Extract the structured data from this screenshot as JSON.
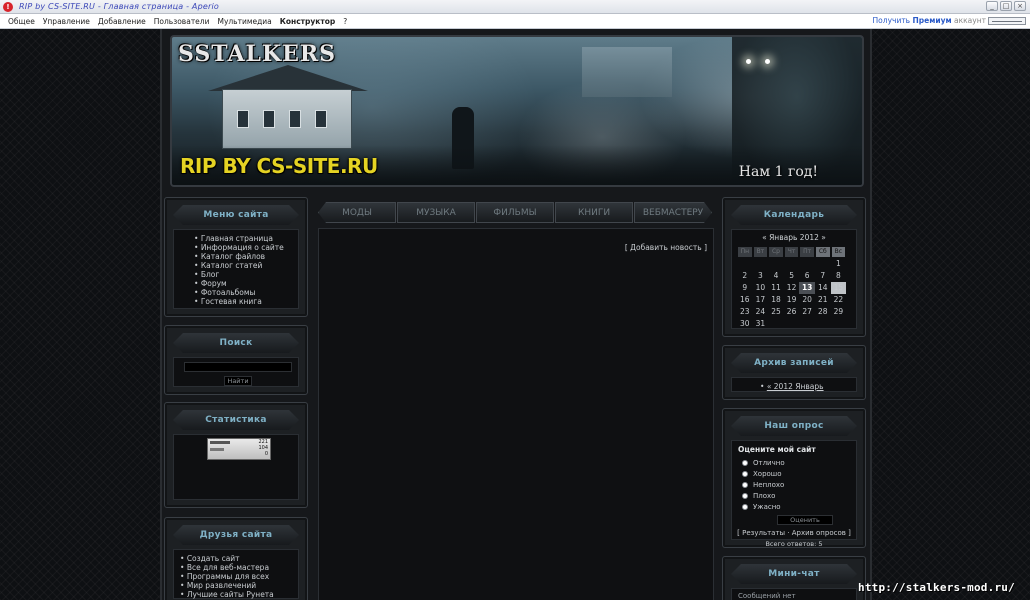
{
  "window": {
    "title": "RIP by CS-SITE.RU - Главная страница - Aperio",
    "premium_prefix": "Получить",
    "premium_word": "Премиум",
    "premium_suffix": "аккаунт",
    "buttons": [
      "_",
      "□",
      "×"
    ]
  },
  "menubar": [
    "Общее",
    "Управление",
    "Добавление",
    "Пользователи",
    "Мультимедиа",
    "Конструктор",
    "?"
  ],
  "header": {
    "logo": "SSTALKERS",
    "rip": "RIP BY CS-SITE.RU",
    "year": "Нам 1 год!"
  },
  "nav": [
    "МОДЫ",
    "МУЗЫКА",
    "ФИЛЬМЫ",
    "КНИГИ",
    "ВЕБМАСТЕРУ"
  ],
  "content": {
    "add_news": "[ Добавить новость ]"
  },
  "left": {
    "menu_title": "Меню сайта",
    "menu_items": [
      "Главная страница",
      "Информация о сайте",
      "Каталог файлов",
      "Каталог статей",
      "Блог",
      "Форум",
      "Фотоальбомы",
      "Гостевая книга"
    ],
    "search_title": "Поиск",
    "search_button": "Найти",
    "stats_title": "Статистика",
    "counter": [
      "221",
      "104",
      "0"
    ],
    "friends_title": "Друзья сайта",
    "friends_items": [
      "Создать сайт",
      "Все для веб-мастера",
      "Программы для всех",
      "Мир развлечений",
      "Лучшие сайты Рунета"
    ]
  },
  "right": {
    "calendar_title": "Календарь",
    "calendar_month": "«  Январь 2012  »",
    "calendar_days_header": [
      "Пн",
      "Вт",
      "Ср",
      "Чт",
      "Пт",
      "Сб",
      "Вс"
    ],
    "calendar_days": [
      "",
      "",
      "",
      "",
      "",
      "",
      "1",
      "2",
      "3",
      "4",
      "5",
      "6",
      "7",
      "8",
      "9",
      "10",
      "11",
      "12",
      "13",
      "14",
      "15",
      "16",
      "17",
      "18",
      "19",
      "20",
      "21",
      "22",
      "23",
      "24",
      "25",
      "26",
      "27",
      "28",
      "29",
      "30",
      "31"
    ],
    "calendar_today": "13",
    "archive_title": "Архив записей",
    "archive_item": "« 2012 Январь",
    "poll_title": "Наш опрос",
    "poll_question": "Оцените мой сайт",
    "poll_options": [
      "Отлично",
      "Хорошо",
      "Неплохо",
      "Плохо",
      "Ужасно"
    ],
    "poll_button": "Оценить",
    "poll_links": "[ Результаты · Архив опросов ]",
    "poll_total": "Всего ответов: 5",
    "chat_title": "Мини-чат",
    "chat_text": "Сообщений нет"
  },
  "watermark": "http://stalkers-mod.ru/"
}
